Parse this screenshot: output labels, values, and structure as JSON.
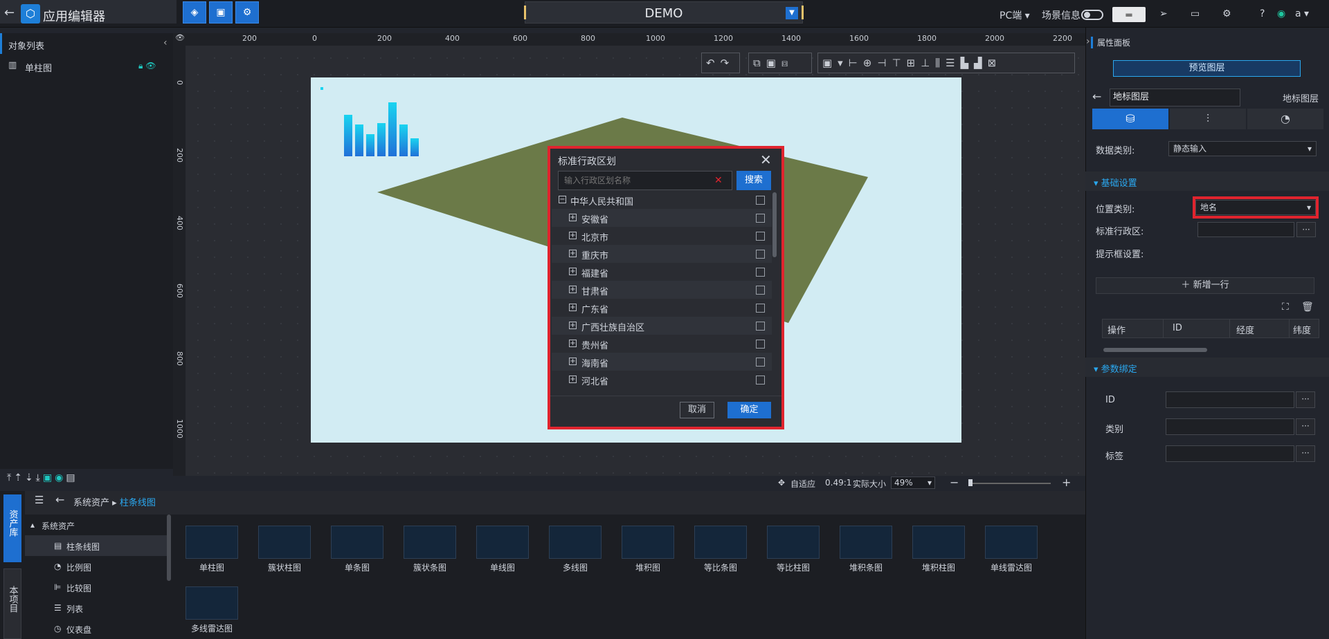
{
  "app": {
    "title": "应用编辑器",
    "scene_name": "DEMO"
  },
  "topbar": {
    "pc_mode": "PC端",
    "scene_info": "场景信息",
    "user": "a"
  },
  "left_panel": {
    "title": "对象列表",
    "items": [
      {
        "label": "单柱图"
      }
    ]
  },
  "rulers": {
    "top": [
      "200",
      "0",
      "200",
      "400",
      "600",
      "800",
      "1000",
      "1200",
      "1400",
      "1600",
      "1800",
      "2000",
      "2200"
    ],
    "left": [
      "0",
      "200",
      "400",
      "600",
      "800",
      "1000"
    ]
  },
  "dialog": {
    "title": "标准行政区划",
    "search_placeholder": "输入行政区划名称",
    "search_button": "搜索",
    "root": "中华人民共和国",
    "items": [
      "安徽省",
      "北京市",
      "重庆市",
      "福建省",
      "甘肃省",
      "广东省",
      "广西壮族自治区",
      "贵州省",
      "海南省",
      "河北省"
    ],
    "cancel": "取消",
    "ok": "确定"
  },
  "zoom_bar": {
    "fit": "自适应",
    "ratio": "0.49:1",
    "actual": "实际大小",
    "zoom": "49%"
  },
  "assets": {
    "tab_assets": "资产库",
    "tab_project": "本项目",
    "breadcrumb_root": "系统资产",
    "breadcrumb_current": "柱条线图",
    "tree": [
      {
        "label": "系统资产"
      },
      {
        "label": "柱条线图"
      },
      {
        "label": "比例图"
      },
      {
        "label": "比较图"
      },
      {
        "label": "列表"
      },
      {
        "label": "仪表盘"
      }
    ],
    "items": [
      "单柱图",
      "簇状柱图",
      "单条图",
      "簇状条图",
      "单线图",
      "多线图",
      "堆积图",
      "等比条图",
      "等比柱图",
      "堆积条图",
      "堆积柱图",
      "单线雷达图",
      "多线雷达图"
    ]
  },
  "right_panel": {
    "header": "属性面板",
    "preview_button": "预览图层",
    "layer_name": "地标图层",
    "layer_type": "地标图层",
    "data_type_label": "数据类别:",
    "data_type_value": "静态输入",
    "section_basic": "基础设置",
    "position_type_label": "位置类别:",
    "position_type_value": "地名",
    "admin_label": "标准行政区:",
    "tooltip_label": "提示框设置:",
    "add_row": "新增一行",
    "table_headers": [
      "操作",
      "ID",
      "经度",
      "纬度"
    ],
    "section_params": "参数绑定",
    "param_fields": [
      "ID",
      "类别",
      "标签"
    ]
  },
  "colors": {
    "accent": "#1e6fd0",
    "highlight": "#e0242e",
    "plane": "#6b7a48",
    "scene_bg": "#d2ecf3"
  }
}
